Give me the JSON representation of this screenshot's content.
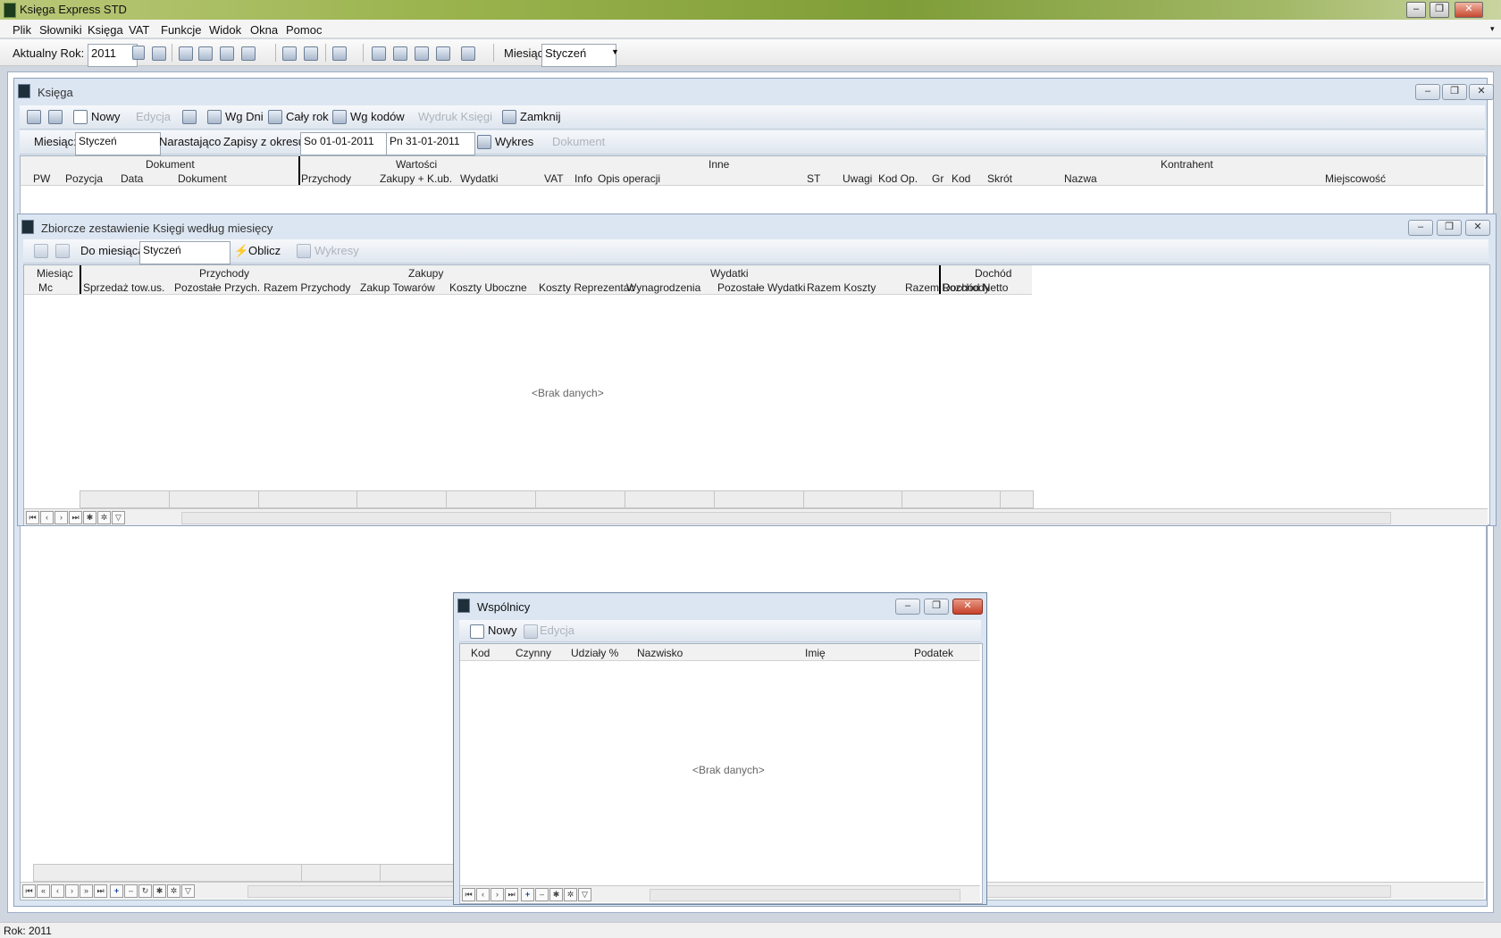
{
  "app": {
    "title": "Księga Express STD"
  },
  "menu": [
    "Plik",
    "Słowniki",
    "Księga",
    "VAT",
    "Funkcje",
    "Widok",
    "Okna",
    "Pomoc"
  ],
  "toolbar": {
    "year_label": "Aktualny Rok:",
    "year_value": "2011",
    "month_label": "Miesiąc",
    "month_value": "Styczeń"
  },
  "ksiega": {
    "title": "Księga",
    "actions": {
      "new": "Nowy",
      "edit": "Edycja",
      "by_days": "Wg Dni",
      "whole_year": "Cały rok",
      "by_codes": "Wg kodów",
      "print": "Wydruk Księgi",
      "close": "Zamknij"
    },
    "filter": {
      "month_label": "Miesiąc:",
      "month_value": "Styczeń",
      "cumulative": "Narastająco",
      "range_label": "Zapisy z okresu:",
      "date_from": "So 01-01-2011",
      "date_to": "Pn 31-01-2011",
      "chart": "Wykres",
      "document": "Dokument"
    },
    "groups": [
      "Dokument",
      "Wartości",
      "Inne",
      "Kontrahent"
    ],
    "columns": [
      "PW",
      "Pozycja",
      "Data",
      "Dokument",
      "Przychody",
      "Zakupy + K.ub.",
      "Wydatki",
      "VAT",
      "Info",
      "Opis operacji",
      "ST",
      "Uwagi",
      "Kod Op.",
      "Gr",
      "Kod",
      "Skrót",
      "Nazwa",
      "Miejscowość"
    ]
  },
  "summary": {
    "title": "Zbiorcze zestawienie Księgi według miesięcy",
    "actions": {
      "to_month_label": "Do miesiąca",
      "to_month_value": "Styczeń",
      "compute": "Oblicz",
      "charts": "Wykresy"
    },
    "groups": [
      "Miesiąc",
      "Przychody",
      "Zakupy",
      "Wydatki",
      "Dochód"
    ],
    "columns": [
      "Mc",
      "Sprzedaż tow.us.",
      "Pozostałe Przych.",
      "Razem Przychody",
      "Zakup Towarów",
      "Koszty Uboczne",
      "Koszty Reprezentac",
      "Wynagrodzenia",
      "Pozostałe Wydatki",
      "Razem Koszty",
      "Razem Rozchody",
      "Dochód Netto"
    ],
    "empty": "<Brak danych>"
  },
  "partners": {
    "title": "Wspólnicy",
    "actions": {
      "new": "Nowy",
      "edit": "Edycja"
    },
    "columns": [
      "Kod",
      "Czynny",
      "Udziały %",
      "Nazwisko",
      "Imię",
      "Podatek"
    ],
    "empty": "<Brak danych>"
  },
  "status": {
    "text": "Rok: 2011"
  }
}
